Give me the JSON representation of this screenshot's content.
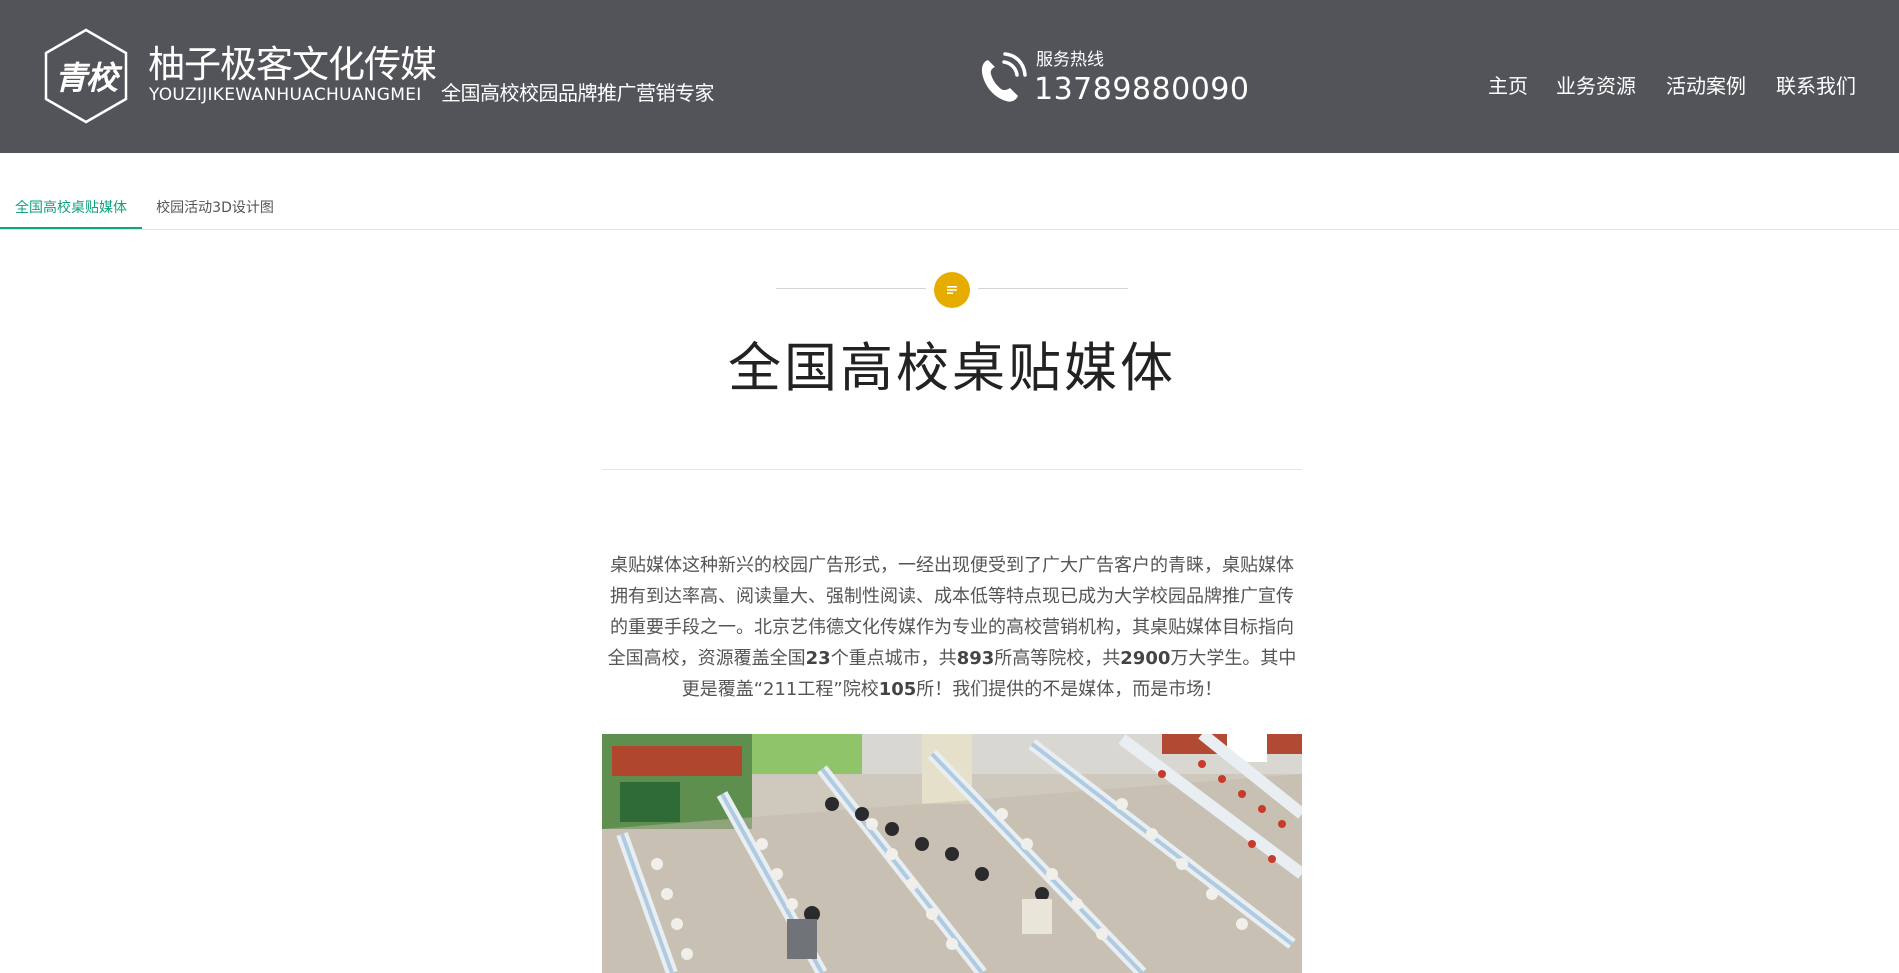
{
  "header": {
    "logo_text": "青校",
    "brand_name": "柚子极客文化传媒",
    "brand_pinyin": "YOUZIJIKEWANHUACHUANGMEI",
    "brand_slogan": "全国高校校园品牌推广营销专家",
    "hotline_label": "服务热线",
    "hotline_number": "13789880090",
    "nav": [
      {
        "label": "主页"
      },
      {
        "label": "业务资源"
      },
      {
        "label": "活动案例"
      },
      {
        "label": "联系我们"
      }
    ],
    "background_color": "#535459"
  },
  "tabs": [
    {
      "label": "全国高校桌贴媒体",
      "active": true
    },
    {
      "label": "校园活动3D设计图",
      "active": false
    }
  ],
  "content": {
    "badge_icon": "document-lines-icon",
    "title": "全国高校桌贴媒体",
    "article": {
      "s1": "桌贴媒体这种新兴的校园广告形式，一经出现便受到了广大广告客户的青睐，桌贴媒体拥有到达率高、阅读量大、强制性阅读、成本低等特点现已成为大学校园品牌推广宣传的重要手段之一。北京艺伟德文化传媒作为专业的高校营销机构，其桌贴媒体目标指向全国高校，资源覆盖全国",
      "n1": "23",
      "s2": "个重点城市，共",
      "n2": "893",
      "s3": "所高等院校，共",
      "n3": "2900",
      "s4": "万大学生。其中更是覆盖“211工程”院校",
      "n4": "105",
      "s5": "所！我们提供的不是媒体，而是市场！"
    },
    "photo": "cafeteria-photo"
  },
  "colors": {
    "accent": "#10a37f",
    "badge": "#e6ac00"
  }
}
